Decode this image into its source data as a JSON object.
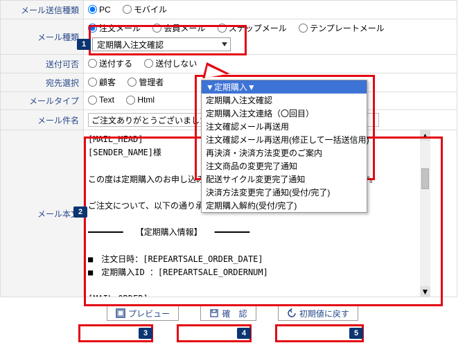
{
  "rows": {
    "send_type": {
      "label": "メール送信種類",
      "options": [
        "PC",
        "モバイル"
      ],
      "selected": 0
    },
    "mail_type": {
      "label": "メール種類",
      "options": [
        "注文メール",
        "会員メール",
        "ステップメール",
        "テンプレートメール"
      ],
      "selected": 0,
      "dropdown_value": "定期購入注文確認"
    },
    "can_send": {
      "label": "送付可否",
      "options": [
        "送付する",
        "送付しない"
      ]
    },
    "addressee": {
      "label": "宛先選択",
      "options": [
        "顧客",
        "管理者"
      ]
    },
    "mail_format": {
      "label": "メールタイプ",
      "options": [
        "Text",
        "Html"
      ]
    },
    "subject": {
      "label": "メール件名",
      "value": "ご注文ありがとうございました"
    },
    "body": {
      "label": "メール本文",
      "text": "[MAIL_HEAD]\n[SENDER_NAME]様\n\nこの度は定期購入のお申し込みをいただき、まことにありがとうございます。\n\nご注文について、以下の通り承りました。\n\n━━━━━━━　　【定期購入情報】　　━━━━━━━\n\n■　注文日時：[REPEARTSALE_ORDER_DATE]\n■　定期購入ID ：[REPEARTSALE_ORDERNUM]\n\n[MAIL_ORDER]\n\n\n━━━━━━━　　【ご注文情報】　　━━━━━━━"
    }
  },
  "dropdown_menu": [
    "▼定期購入▼",
    "定期購入注文確認",
    "定期購入注文連絡（〇回目）",
    "注文確認メール再送用",
    "注文確認メール再送用(修正して一括送信用)",
    "再決済・決済方法変更のご案内",
    "注文商品の変更完了通知",
    "配送サイクル変更完了通知",
    "決済方法変更完了通知(受付/完了)",
    "定期購入解約(受付/完了)"
  ],
  "buttons": {
    "preview": "プレビュー",
    "confirm": "確　認",
    "reset": "初期値に戻す"
  },
  "callouts": {
    "1": "1",
    "2": "2",
    "3": "3",
    "4": "4",
    "5": "5"
  }
}
